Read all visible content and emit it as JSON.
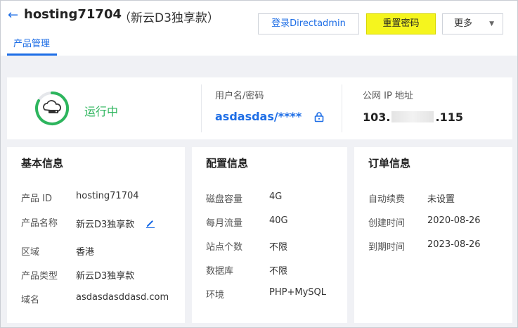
{
  "header": {
    "title": "hosting71704",
    "subtitle": "（新云D3独享款）",
    "login_button": "登录Directadmin",
    "reset_button": "重置密码",
    "more_button": "更多",
    "tab": "产品管理"
  },
  "status": {
    "text": "运行中",
    "color": "#2db55d"
  },
  "credentials": {
    "label": "用户名/密码",
    "value": "asdasdas/****"
  },
  "ip": {
    "label": "公网 IP 地址",
    "prefix": "103.",
    "suffix": ".115"
  },
  "basic_info": {
    "title": "基本信息",
    "rows": [
      {
        "key": "产品 ID",
        "value": "hosting71704"
      },
      {
        "key": "产品名称",
        "value": "新云D3独享款"
      },
      {
        "key": "区域",
        "value": "香港"
      },
      {
        "key": "产品类型",
        "value": "新云D3独享款"
      },
      {
        "key": "域名",
        "value": "asdasdasddasd.com"
      }
    ]
  },
  "config_info": {
    "title": "配置信息",
    "rows": [
      {
        "key": "磁盘容量",
        "value": "4G"
      },
      {
        "key": "每月流量",
        "value": "40G"
      },
      {
        "key": "站点个数",
        "value": "不限"
      },
      {
        "key": "数据库",
        "value": "不限"
      },
      {
        "key": "环境",
        "value": "PHP+MySQL"
      }
    ]
  },
  "order_info": {
    "title": "订单信息",
    "rows": [
      {
        "key": "自动续费",
        "value": "未设置"
      },
      {
        "key": "创建时间",
        "value": "2020-08-26"
      },
      {
        "key": "到期时间",
        "value": "2023-08-26"
      }
    ]
  },
  "colors": {
    "accent": "#1e6ee6",
    "reset_button_bg": "#f5f51e",
    "running_green": "#2db55d"
  }
}
